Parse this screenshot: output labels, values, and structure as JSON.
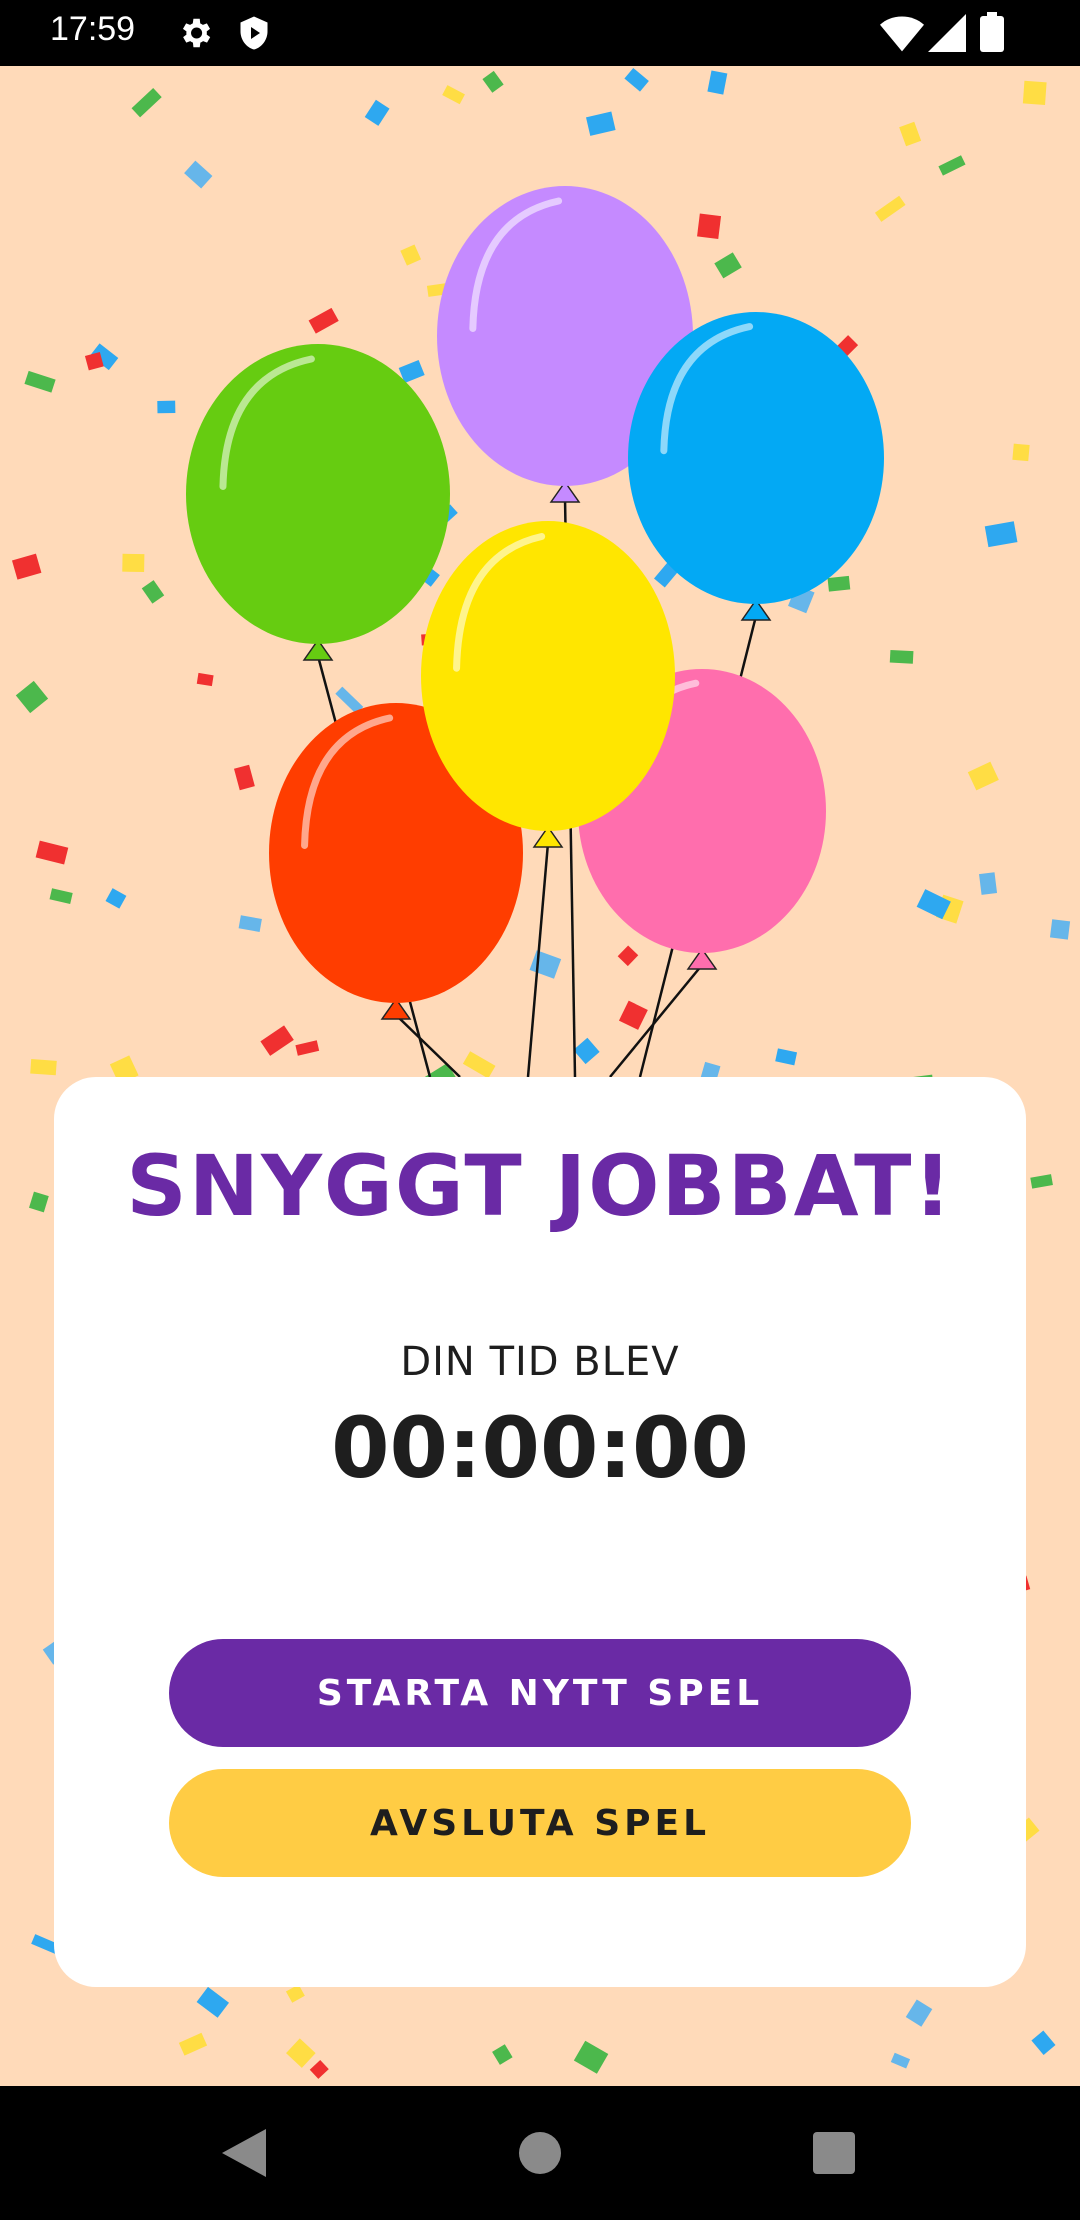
{
  "status_bar": {
    "time": "17:59",
    "icons": [
      "settings-icon",
      "play-protect-icon",
      "wifi-icon",
      "signal-icon",
      "battery-icon"
    ]
  },
  "result": {
    "title": "SNYGGT JOBBAT!",
    "time_label": "DIN TID BLEV",
    "time_value": "00:00:00"
  },
  "buttons": {
    "new_game": "STARTA NYTT SPEL",
    "quit_game": "AVSLUTA SPEL"
  },
  "nav_bar": {
    "icons": [
      "back-icon",
      "home-icon",
      "recents-icon"
    ]
  },
  "colors": {
    "background": "#FFDAB9",
    "title": "#6A2AA5",
    "primary_button": "#6A2AA5",
    "secondary_button": "#FFCC44",
    "balloon_purple": "#C58AFF",
    "balloon_blue": "#03A9F4",
    "balloon_green": "#66CC11",
    "balloon_yellow": "#FFE600",
    "balloon_pink": "#FF6EAD",
    "balloon_red": "#FF3D00"
  }
}
